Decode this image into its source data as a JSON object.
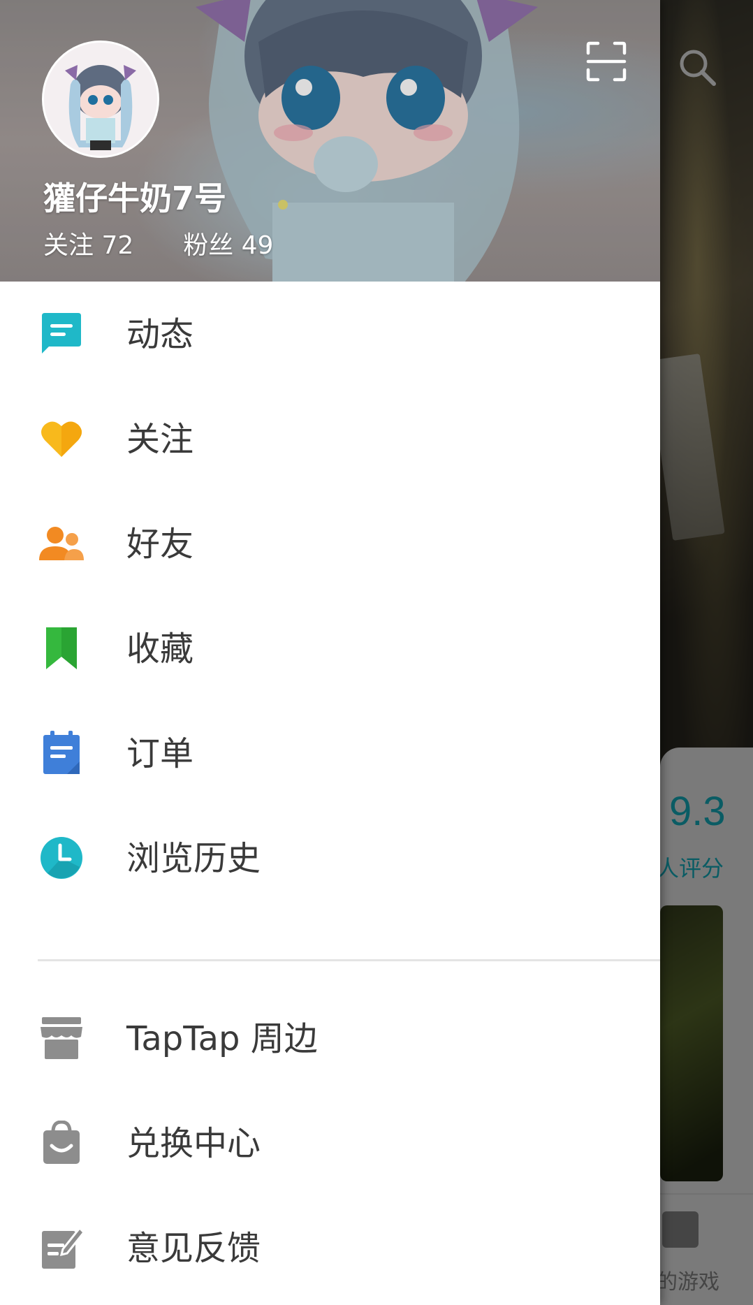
{
  "background": {
    "score": "9.3",
    "score_label": "人评分",
    "tab_label": "的游戏"
  },
  "profile": {
    "username": "獾仔牛奶7号",
    "following_label": "关注",
    "following_count": "72",
    "followers_label": "粉丝",
    "followers_count": "49"
  },
  "menu_primary": [
    {
      "label": "动态",
      "icon": "feed-icon",
      "color": "#1fb8c8"
    },
    {
      "label": "关注",
      "icon": "heart-icon",
      "color": "#f8b91c"
    },
    {
      "label": "好友",
      "icon": "friends-icon",
      "color": "#f28a22"
    },
    {
      "label": "收藏",
      "icon": "bookmark-icon",
      "color": "#35b83e"
    },
    {
      "label": "订单",
      "icon": "order-icon",
      "color": "#3f7fd9"
    },
    {
      "label": "浏览历史",
      "icon": "clock-icon",
      "color": "#1fb8c8"
    }
  ],
  "menu_secondary": [
    {
      "label": "TapTap 周边",
      "icon": "store-icon",
      "color": "#8d8d8d"
    },
    {
      "label": "兑换中心",
      "icon": "shopping-bag-icon",
      "color": "#8d8d8d"
    },
    {
      "label": "意见反馈",
      "icon": "feedback-icon",
      "color": "#8d8d8d"
    }
  ]
}
